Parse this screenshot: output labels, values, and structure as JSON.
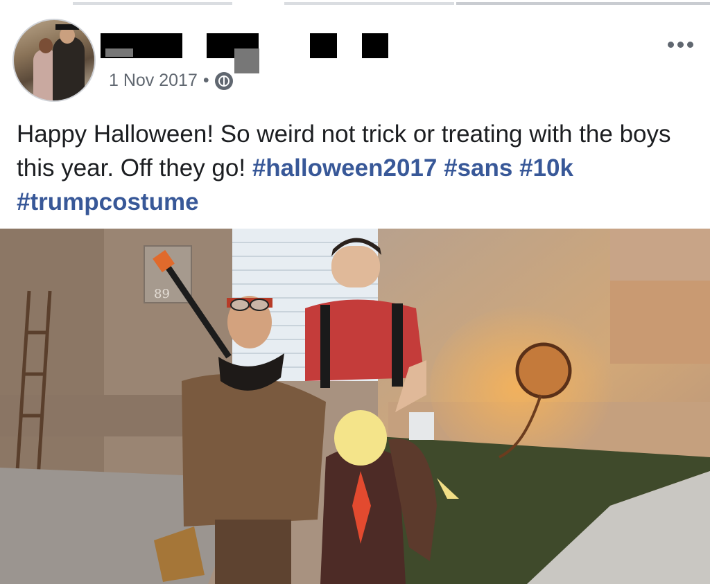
{
  "post": {
    "date": "1 Nov 2017",
    "separator": "•",
    "text_intro": "Happy Halloween! So weird not trick or treating with the boys this year. Off they go! ",
    "hashtags": [
      "#halloween2017",
      "#sans",
      "#10k",
      "#trumpcostume"
    ]
  },
  "header": {
    "privacy_icon": "globe-icon",
    "menu_icon": "more-options-icon"
  },
  "photo": {
    "house_number": "89"
  },
  "colors": {
    "hashtag": "#385898",
    "meta": "#606770",
    "text": "#1c1e21"
  }
}
